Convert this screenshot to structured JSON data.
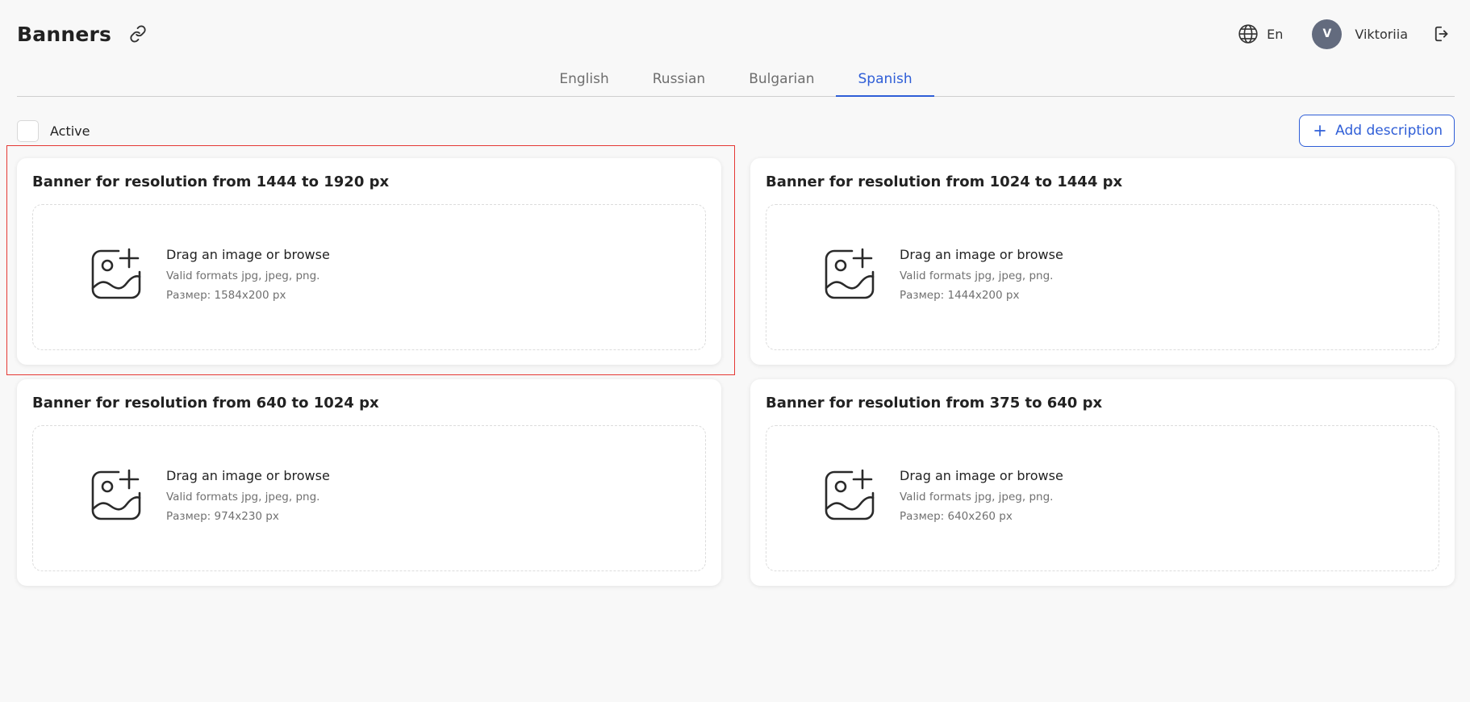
{
  "header": {
    "title": "Banners",
    "language_code": "En",
    "user": {
      "initial": "V",
      "name": "Viktoriia"
    }
  },
  "tabs": [
    {
      "label": "English",
      "active": false
    },
    {
      "label": "Russian",
      "active": false
    },
    {
      "label": "Bulgarian",
      "active": false
    },
    {
      "label": "Spanish",
      "active": true
    }
  ],
  "toolbar": {
    "active_label": "Active",
    "add_description_label": "Add description"
  },
  "cards": [
    {
      "title": "Banner for resolution from 1444 to 1920 px",
      "drop_title": "Drag an image or browse",
      "formats": "Valid formats jpg, jpeg, png.",
      "size": "Размер: 1584x200 px"
    },
    {
      "title": "Banner for resolution from 1024 to 1444 px",
      "drop_title": "Drag an image or browse",
      "formats": "Valid formats jpg, jpeg, png.",
      "size": "Размер: 1444x200 px"
    },
    {
      "title": "Banner for resolution from 640 to 1024 px",
      "drop_title": "Drag an image or browse",
      "formats": "Valid formats jpg, jpeg, png.",
      "size": "Размер: 974x230 px"
    },
    {
      "title": "Banner for resolution from 375 to 640 px",
      "drop_title": "Drag an image or browse",
      "formats": "Valid formats jpg, jpeg, png.",
      "size": "Размер: 640x260 px"
    }
  ],
  "colors": {
    "accent": "#2f5ed7",
    "avatar_bg": "#636b7e",
    "highlight": "#e53935"
  },
  "icons": [
    "link-icon",
    "globe-icon",
    "logout-icon",
    "plus-icon",
    "add-image-icon"
  ]
}
